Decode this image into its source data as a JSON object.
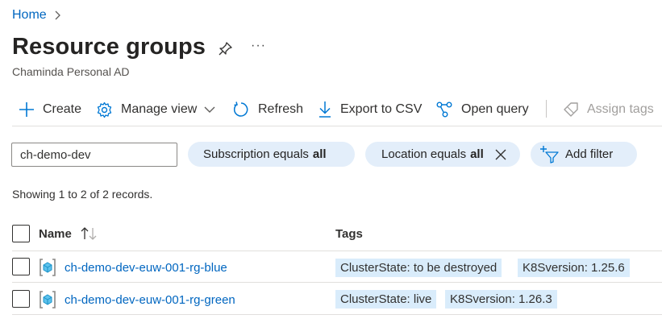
{
  "breadcrumb": {
    "home": "Home"
  },
  "header": {
    "title": "Resource groups",
    "more": "···",
    "subtitle": "Chaminda Personal AD"
  },
  "toolbar": {
    "create": "Create",
    "manage_view": "Manage view",
    "refresh": "Refresh",
    "export": "Export to CSV",
    "open_query": "Open query",
    "assign_tags": "Assign tags"
  },
  "filters": {
    "search_value": "ch-demo-dev",
    "subscription_prefix": "Subscription equals",
    "subscription_value": "all",
    "location_prefix": "Location equals",
    "location_value": "all",
    "add_filter": "Add filter"
  },
  "records_text": "Showing 1 to 2 of 2 records.",
  "table": {
    "columns": {
      "name": "Name",
      "tags": "Tags"
    },
    "rows": [
      {
        "name": "ch-demo-dev-euw-001-rg-blue",
        "tags": [
          "ClusterState: to be destroyed",
          "K8Sversion: 1.25.6"
        ]
      },
      {
        "name": "ch-demo-dev-euw-001-rg-green",
        "tags": [
          "ClusterState: live",
          "K8Sversion: 1.26.3"
        ]
      }
    ]
  },
  "colors": {
    "link": "#0066c0",
    "accent": "#0078d4",
    "pill_bg": "#e3eefa",
    "tag_bg": "#d9ecfb"
  }
}
